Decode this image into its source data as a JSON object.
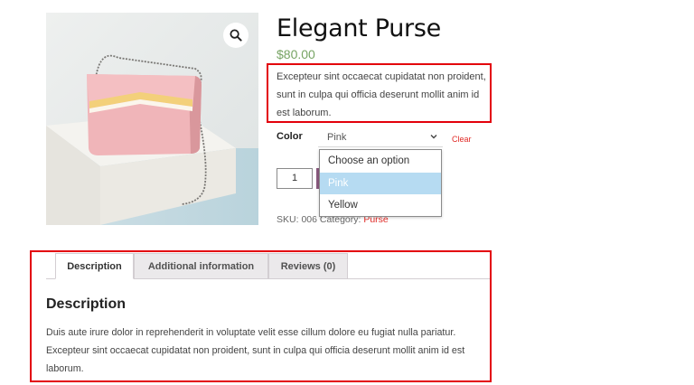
{
  "product": {
    "title": "Elegant Purse",
    "price": "$80.00",
    "short_description": "Excepteur sint occaecat cupidatat non proident, sunt in culpa qui officia deserunt mollit anim id est laborum.",
    "image_icon": "purse-photo",
    "zoom_icon": "magnifier-icon"
  },
  "variation": {
    "label": "Color",
    "selected": "Pink",
    "reset_label": "Clear",
    "options": [
      "Choose an option",
      "Pink",
      "Yellow"
    ],
    "highlighted_index": 1
  },
  "cart": {
    "quantity": "1"
  },
  "meta": {
    "sku_label": "SKU:",
    "sku_value": "006",
    "category_label": "Category:",
    "category_value": "Purse"
  },
  "tabs": {
    "items": [
      {
        "label": "Description"
      },
      {
        "label": "Additional information"
      },
      {
        "label": "Reviews (0)"
      }
    ],
    "active_index": 0
  },
  "panel": {
    "heading": "Description",
    "text": "Duis aute irure dolor in reprehenderit in voluptate velit esse cillum dolore eu fugiat nulla pariatur. Excepteur sint occaecat cupidatat non proident, sunt in culpa qui officia deserunt mollit anim id est laborum."
  },
  "colors": {
    "price": "#77a464",
    "highlight_border": "#e3000b",
    "link": "#e02b27",
    "option_selected_bg": "#b6dbf2"
  }
}
